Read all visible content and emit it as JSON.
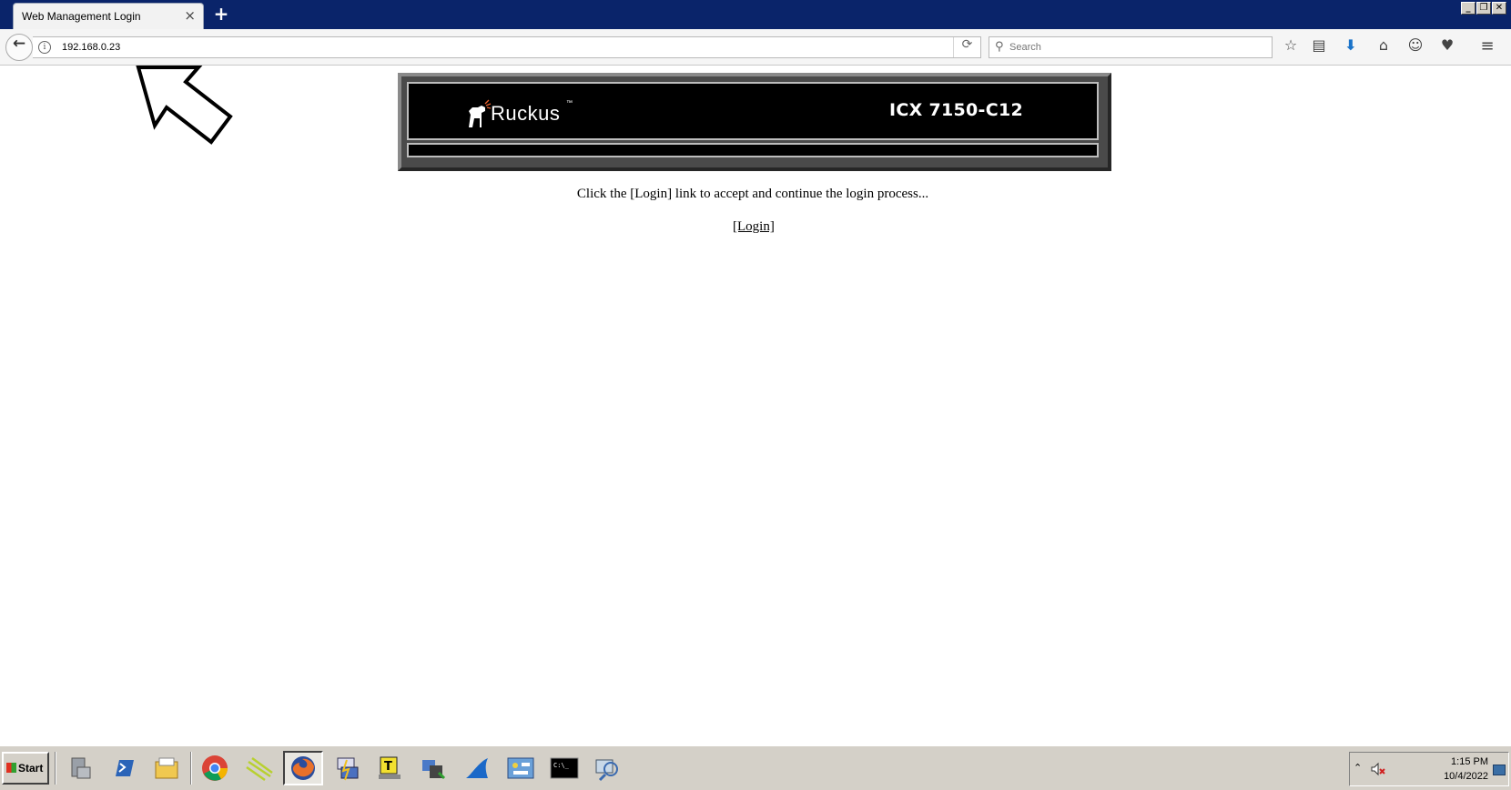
{
  "browser": {
    "tab_title": "Web Management Login",
    "tab_close": "×",
    "new_tab": "+",
    "url": "192.168.0.23",
    "search_placeholder": "Search",
    "window_controls": [
      "_",
      "❐",
      "✕"
    ]
  },
  "page": {
    "logo_text": "Ruckus",
    "logo_tm": "™",
    "model": "ICX 7150-C12",
    "message": "Click the [Login] link to accept and continue the login process...",
    "login_link": "[Login]"
  },
  "taskbar": {
    "start_label": "Start",
    "apps": [
      "server-manager",
      "powershell",
      "file-explorer",
      "chrome",
      "network-tool",
      "firefox",
      "remote-desktop-connection",
      "text-editor",
      "certificate-tool",
      "wireshark",
      "control-panel",
      "command-prompt",
      "network-explorer"
    ],
    "active_app": "firefox",
    "clock_time": "1:15 PM",
    "clock_date": "10/4/2022"
  },
  "colors": {
    "titlebar": "#0a246a",
    "banner_black": "#000000",
    "taskbar": "#d4d0c8"
  }
}
